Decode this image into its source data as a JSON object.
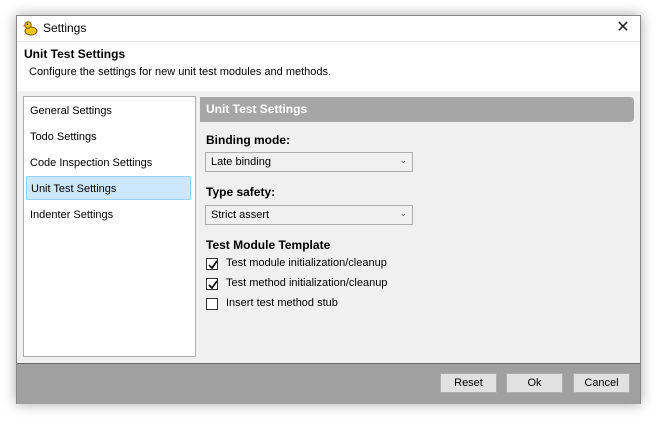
{
  "window": {
    "title": "Settings"
  },
  "header": {
    "title": "Unit Test Settings",
    "description": "Configure the settings for new unit test modules and methods."
  },
  "sidebar": {
    "items": [
      {
        "label": "General Settings",
        "selected": false
      },
      {
        "label": "Todo Settings",
        "selected": false
      },
      {
        "label": "Code Inspection Settings",
        "selected": false
      },
      {
        "label": "Unit Test Settings",
        "selected": true
      },
      {
        "label": "Indenter Settings",
        "selected": false
      }
    ]
  },
  "panel": {
    "title": "Unit Test Settings",
    "binding_mode": {
      "label": "Binding mode:",
      "value": "Late binding"
    },
    "type_safety": {
      "label": "Type safety:",
      "value": "Strict assert"
    },
    "template": {
      "label": "Test Module Template",
      "options": [
        {
          "label": "Test module initialization/cleanup",
          "checked": true
        },
        {
          "label": "Test method initialization/cleanup",
          "checked": true
        },
        {
          "label": "Insert test method stub",
          "checked": false
        }
      ]
    }
  },
  "footer": {
    "reset_label": "Reset",
    "ok_label": "Ok",
    "cancel_label": "Cancel"
  },
  "icons": {
    "app": "duck-icon",
    "close": "close-icon",
    "dropdown": "chevron-down-icon",
    "check": "checkmark-icon"
  },
  "colors": {
    "selected_bg": "#cce8ff",
    "panel_header": "#a6a6a6",
    "footer": "#a0a0a0"
  }
}
